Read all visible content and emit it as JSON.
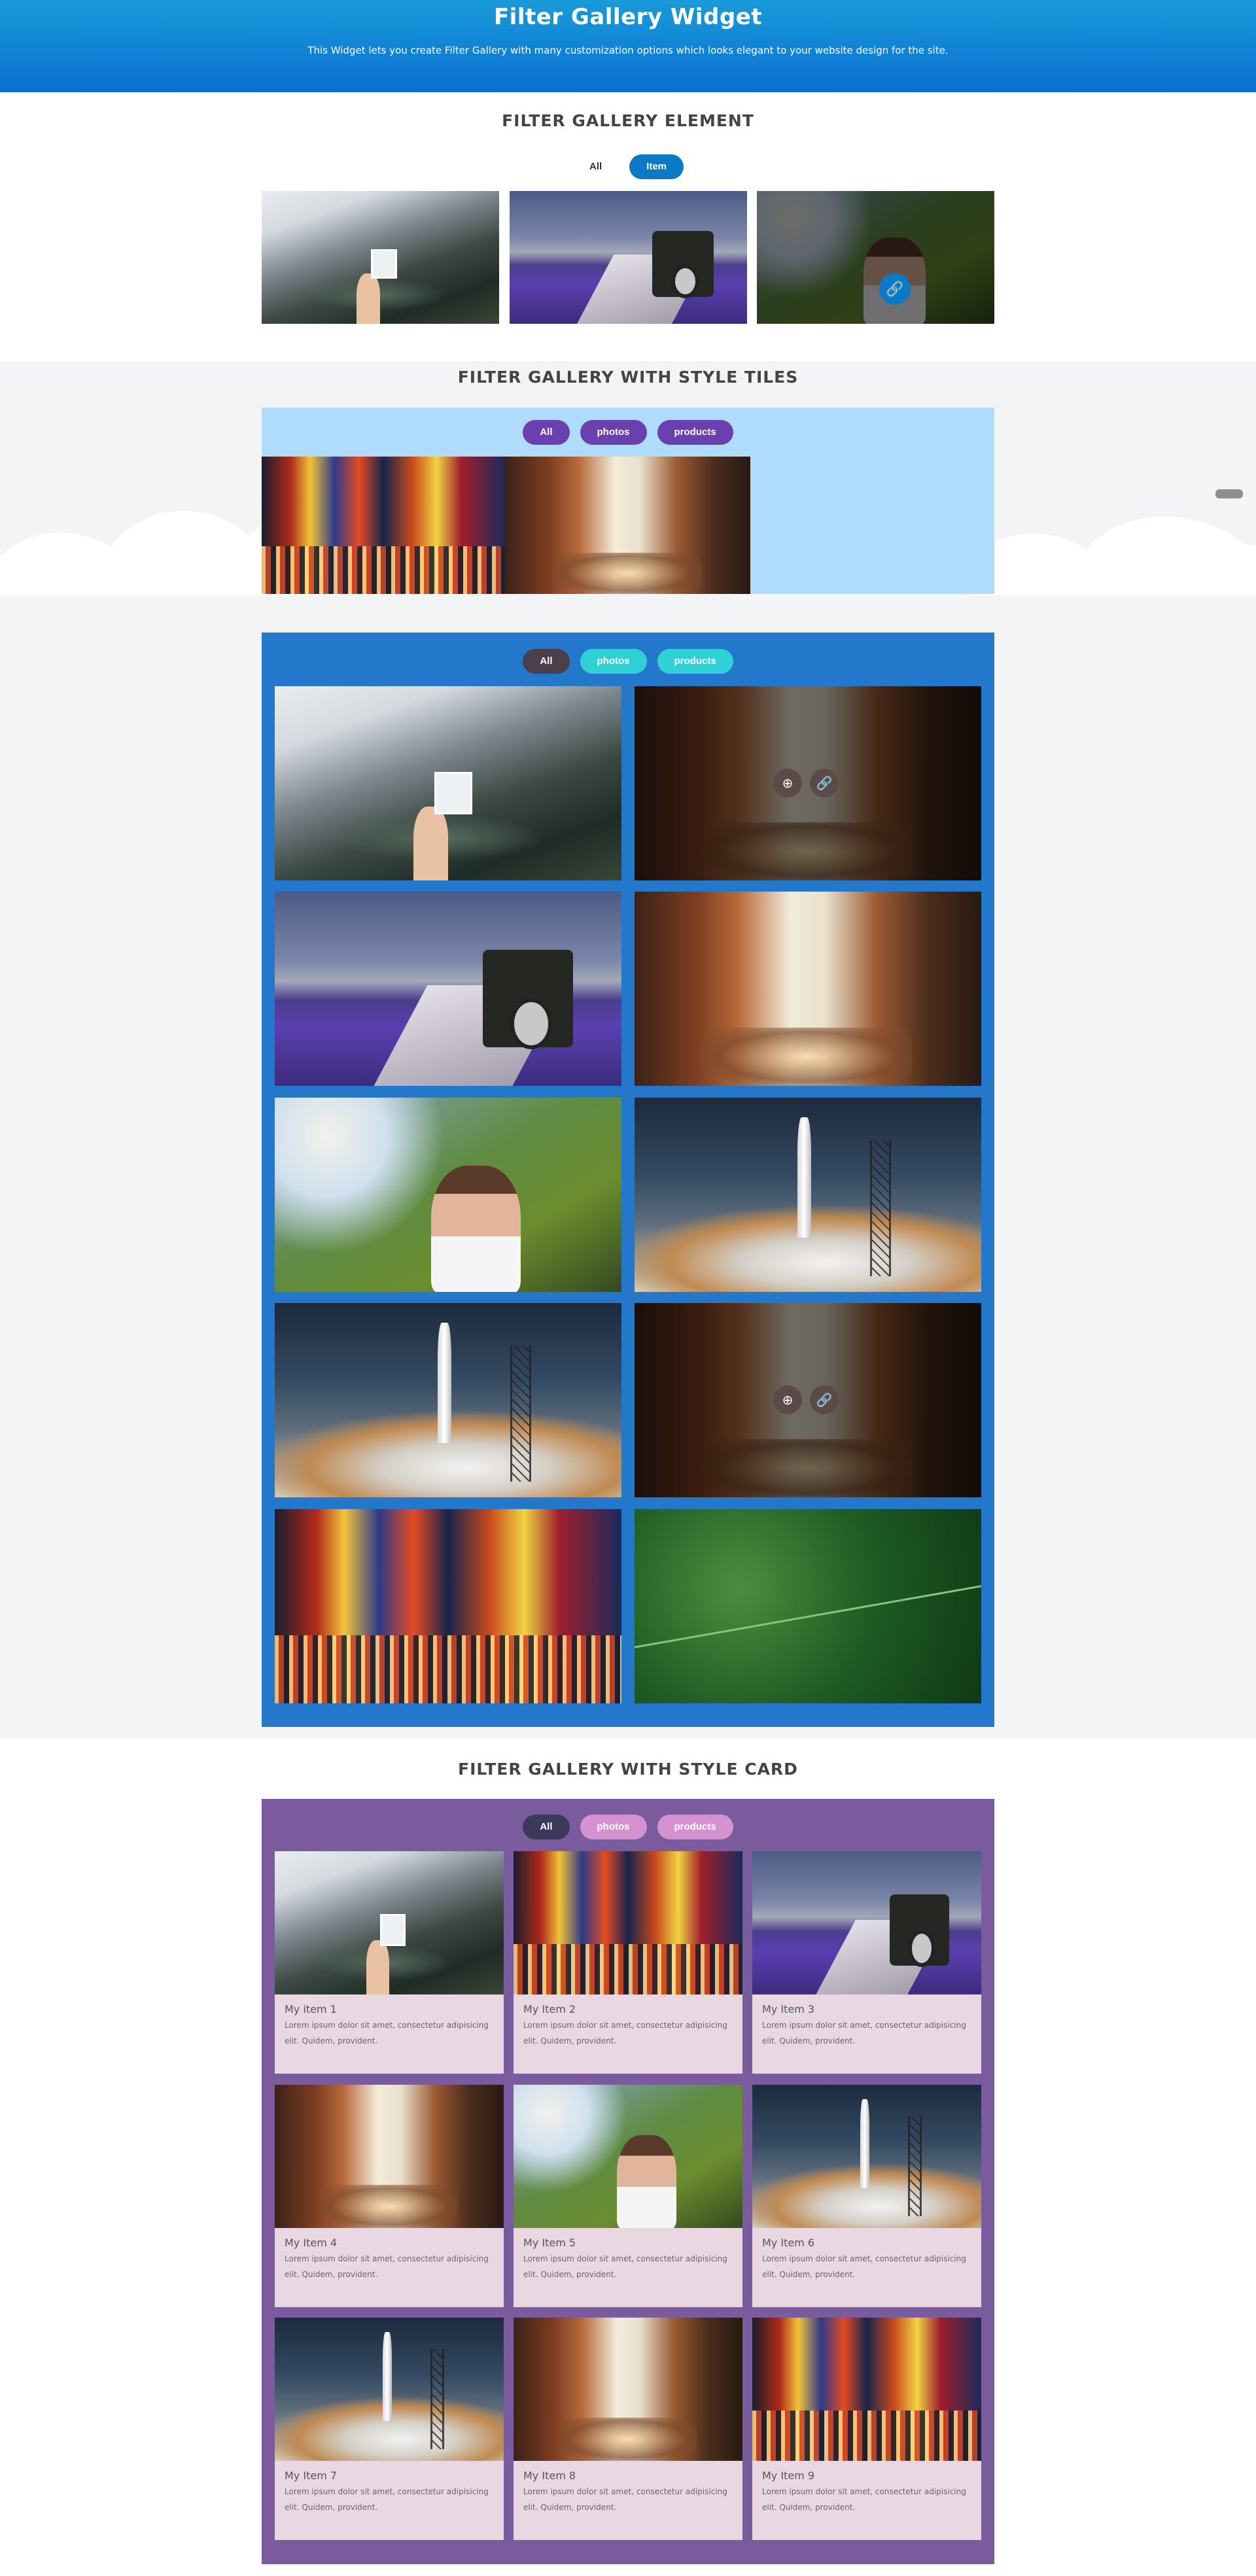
{
  "hero": {
    "title": "Filter Gallery Widget",
    "subtitle": "This Widget lets you create Filter Gallery with many customization options which looks elegant to your website design for the site."
  },
  "section1": {
    "title": "FILTER GALLERY ELEMENT",
    "filters": [
      "All",
      "Item"
    ],
    "active_filter": "Item"
  },
  "section2": {
    "title": "FILTER GALLERY WITH STYLE TILES",
    "filters": [
      "All",
      "photos",
      "products"
    ]
  },
  "section3": {
    "filters": [
      "All",
      "photos",
      "products"
    ],
    "active_filter": "All"
  },
  "section4": {
    "title": "FILTER GALLERY WITH STYLE CARD",
    "filters": [
      "All",
      "photos",
      "products"
    ],
    "active_filter": "All",
    "cards": [
      {
        "title": "My item 1",
        "text": "Lorem ipsum dolor sit amet, consectetur adipisicing elit. Quidem, provident."
      },
      {
        "title": "My Item 2",
        "text": "Lorem ipsum dolor sit amet, consectetur adipisicing elit. Quidem, provident."
      },
      {
        "title": "My Item 3",
        "text": "Lorem ipsum dolor sit amet, consectetur adipisicing elit. Quidem, provident."
      },
      {
        "title": "My Item 4",
        "text": "Lorem ipsum dolor sit amet, consectetur adipisicing elit. Quidem, provident."
      },
      {
        "title": "My Item 5",
        "text": "Lorem ipsum dolor sit amet, consectetur adipisicing elit. Quidem, provident."
      },
      {
        "title": "My Item 6",
        "text": "Lorem ipsum dolor sit amet, consectetur adipisicing elit. Quidem, provident."
      },
      {
        "title": "My Item 7",
        "text": "Lorem ipsum dolor sit amet, consectetur adipisicing elit. Quidem, provident."
      },
      {
        "title": "My Item 8",
        "text": "Lorem ipsum dolor sit amet, consectetur adipisicing elit. Quidem, provident."
      },
      {
        "title": "My Item 9",
        "text": "Lorem ipsum dolor sit amet, consectetur adipisicing elit. Quidem, provident."
      }
    ]
  },
  "icons": {
    "zoom": "zoom-in-icon",
    "link": "link-icon"
  },
  "colors": {
    "hero": "#0a6fd2",
    "pill_blue": "#0b7ac6",
    "pill_purple": "#6a3fae",
    "pill_cyan": "#2fd1d6",
    "pill_dark": "#4a3f4a",
    "pill_pink": "#d492d0",
    "pill_navy": "#3b3a5a"
  }
}
